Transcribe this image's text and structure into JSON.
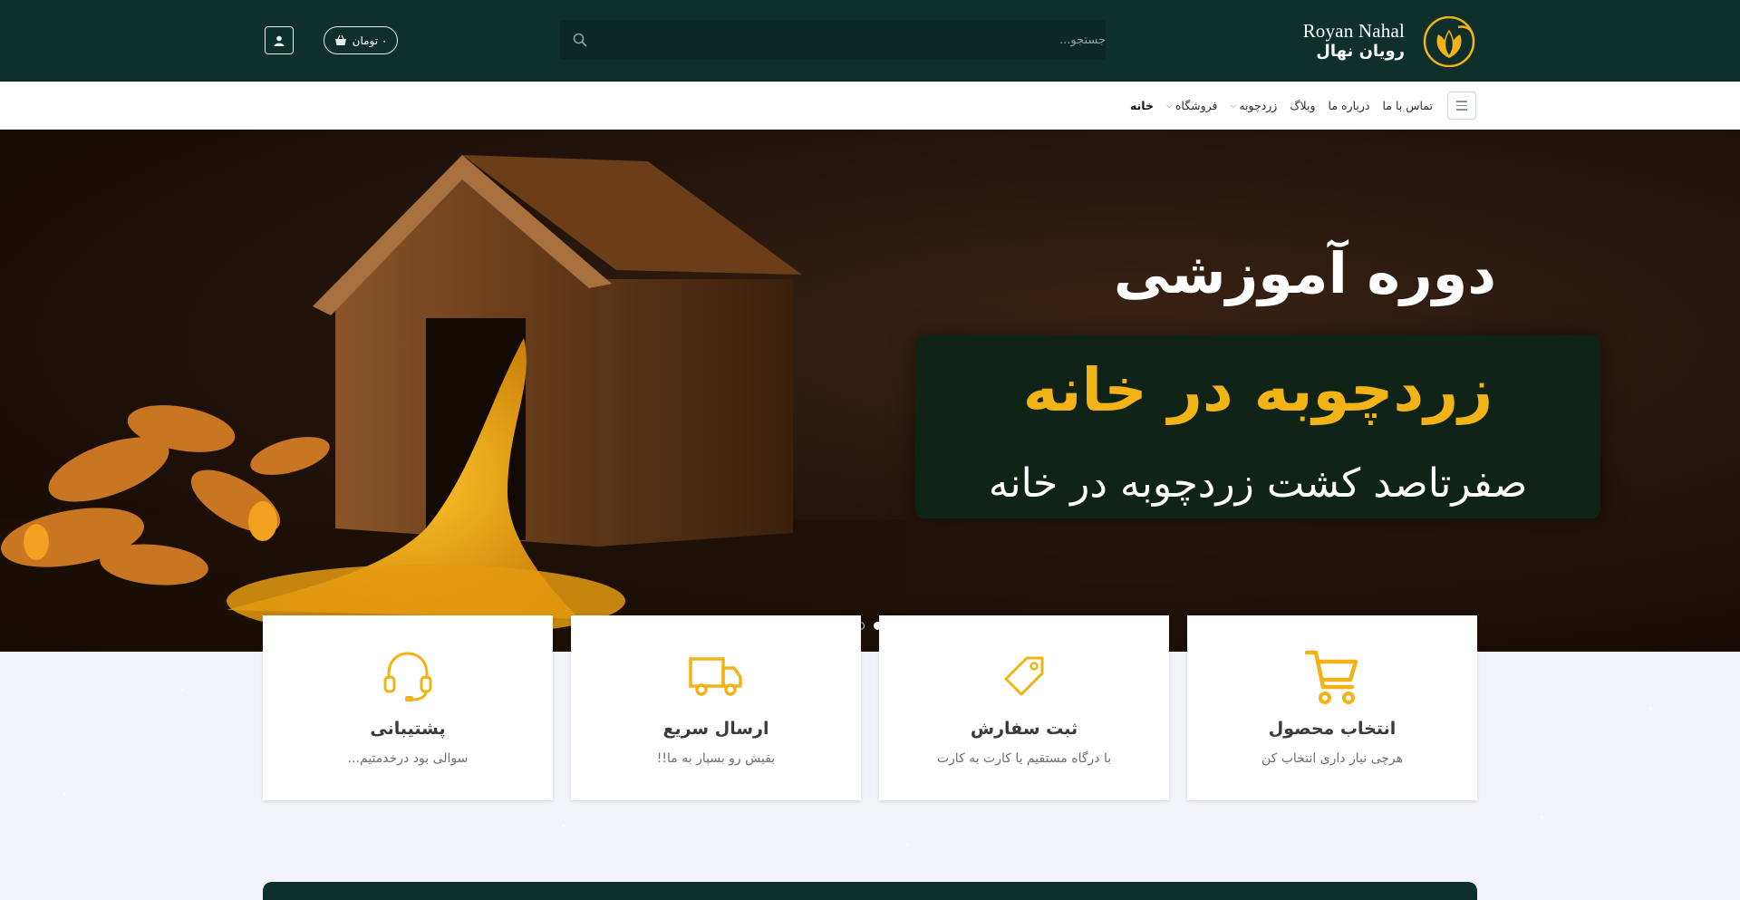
{
  "header": {
    "brand_en": "Royan Nahal",
    "brand_fa": "رویان نهال",
    "search_placeholder": "جستجو...",
    "cart_label": "۰ تومان",
    "colors": {
      "bar": "#0f2f2a",
      "accent": "#f2b316"
    }
  },
  "nav": {
    "items": [
      {
        "label": "خانه",
        "active": true
      },
      {
        "label": "فروشگاه",
        "dropdown": true
      },
      {
        "label": "زردچوبه",
        "dropdown": true
      },
      {
        "label": "وبلاگ"
      },
      {
        "label": "درباره ما"
      },
      {
        "label": "تماس با ما"
      }
    ]
  },
  "hero": {
    "title": "دوره آموزشی",
    "highlight": "زردچوبه در خانه",
    "subtitle": "صفرتاصد کشت زردچوبه در خانه"
  },
  "features": [
    {
      "icon": "cart-icon",
      "title": "انتخاب محصول",
      "desc": "هرچی نیاز داری انتخاب کن"
    },
    {
      "icon": "tag-icon",
      "title": "ثبت سفارش",
      "desc": "با درگاه مستقیم یا کارت به کارت"
    },
    {
      "icon": "truck-icon",
      "title": "ارسال سریع",
      "desc": "بقیش رو بسپار به ما!!"
    },
    {
      "icon": "headset-icon",
      "title": "پشتیبانی",
      "desc": "سوالی بود درخدمتیم..."
    }
  ]
}
